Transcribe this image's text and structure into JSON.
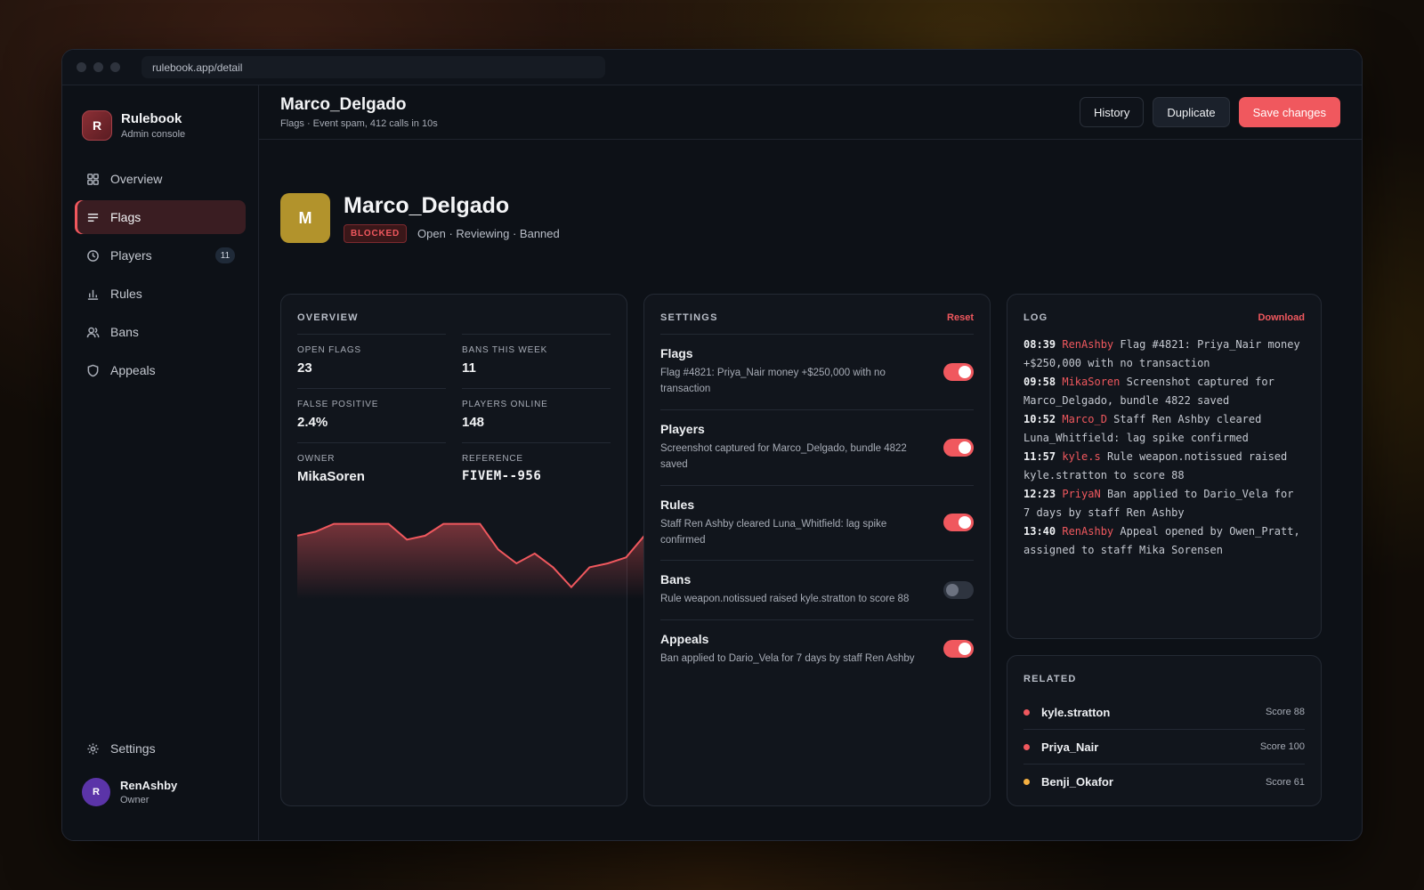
{
  "window": {
    "url": "rulebook.app/detail"
  },
  "brand": {
    "initial": "R",
    "name": "Rulebook",
    "subtitle": "Admin console"
  },
  "nav": {
    "items": [
      {
        "label": "Overview",
        "icon": "grid-icon"
      },
      {
        "label": "Flags",
        "icon": "lines-icon",
        "active": true
      },
      {
        "label": "Players",
        "icon": "clock-icon",
        "badge": "11"
      },
      {
        "label": "Rules",
        "icon": "bar-chart-icon"
      },
      {
        "label": "Bans",
        "icon": "users-icon"
      },
      {
        "label": "Appeals",
        "icon": "shield-icon"
      }
    ],
    "settings_label": "Settings"
  },
  "user": {
    "initial": "R",
    "name": "RenAshby",
    "role": "Owner"
  },
  "header": {
    "title": "Marco_Delgado",
    "subtitle": "Flags · Event spam, 412 calls in 10s",
    "history_label": "History",
    "duplicate_label": "Duplicate",
    "save_label": "Save changes"
  },
  "hero": {
    "initial": "M",
    "name": "Marco_Delgado",
    "status": "BLOCKED",
    "states": "Open · Reviewing · Banned"
  },
  "overview": {
    "title": "OVERVIEW",
    "stats": [
      {
        "label": "OPEN FLAGS",
        "value": "23"
      },
      {
        "label": "BANS THIS WEEK",
        "value": "11"
      },
      {
        "label": "FALSE POSITIVE",
        "value": "2.4%"
      },
      {
        "label": "PLAYERS ONLINE",
        "value": "148"
      },
      {
        "label": "OWNER",
        "value": "MikaSoren"
      },
      {
        "label": "REFERENCE",
        "value": "FIVEM--956"
      }
    ]
  },
  "chart_data": {
    "type": "area",
    "values": [
      62,
      64,
      68,
      68,
      68,
      68,
      60,
      62,
      68,
      68,
      68,
      55,
      48,
      53,
      46,
      36,
      46,
      48,
      51,
      62
    ],
    "ylim": [
      30,
      75
    ],
    "color": "#f0585e"
  },
  "settings": {
    "title": "SETTINGS",
    "reset_label": "Reset",
    "items": [
      {
        "name": "Flags",
        "desc": "Flag #4821: Priya_Nair money +$250,000 with no transaction",
        "on": true
      },
      {
        "name": "Players",
        "desc": "Screenshot captured for Marco_Delgado, bundle 4822 saved",
        "on": true
      },
      {
        "name": "Rules",
        "desc": "Staff Ren Ashby cleared Luna_Whitfield: lag spike confirmed",
        "on": true
      },
      {
        "name": "Bans",
        "desc": "Rule weapon.notissued raised kyle.stratton to score 88",
        "on": false
      },
      {
        "name": "Appeals",
        "desc": "Ban applied to Dario_Vela for 7 days by staff Ren Ashby",
        "on": true
      }
    ]
  },
  "log": {
    "title": "LOG",
    "download_label": "Download",
    "entries": [
      {
        "time": "08:39",
        "user": "RenAshby",
        "text": "Flag #4821: Priya_Nair money +$250,000 with no transaction"
      },
      {
        "time": "09:58",
        "user": "MikaSoren",
        "text": "Screenshot captured for Marco_Delgado, bundle 4822 saved"
      },
      {
        "time": "10:52",
        "user": "Marco_D",
        "text": "Staff Ren Ashby cleared Luna_Whitfield: lag spike confirmed"
      },
      {
        "time": "11:57",
        "user": "kyle.s",
        "text": "Rule weapon.notissued raised kyle.stratton to score 88"
      },
      {
        "time": "12:23",
        "user": "PriyaN",
        "text": "Ban applied to Dario_Vela for 7 days by staff Ren Ashby"
      },
      {
        "time": "13:40",
        "user": "RenAshby",
        "text": "Appeal opened by Owen_Pratt, assigned to staff Mika Sorensen"
      }
    ]
  },
  "related": {
    "title": "RELATED",
    "items": [
      {
        "name": "kyle.stratton",
        "score": "Score 88",
        "color": "#f0585e"
      },
      {
        "name": "Priya_Nair",
        "score": "Score 100",
        "color": "#f0585e"
      },
      {
        "name": "Benji_Okafor",
        "score": "Score 61",
        "color": "#f5b041"
      }
    ]
  }
}
